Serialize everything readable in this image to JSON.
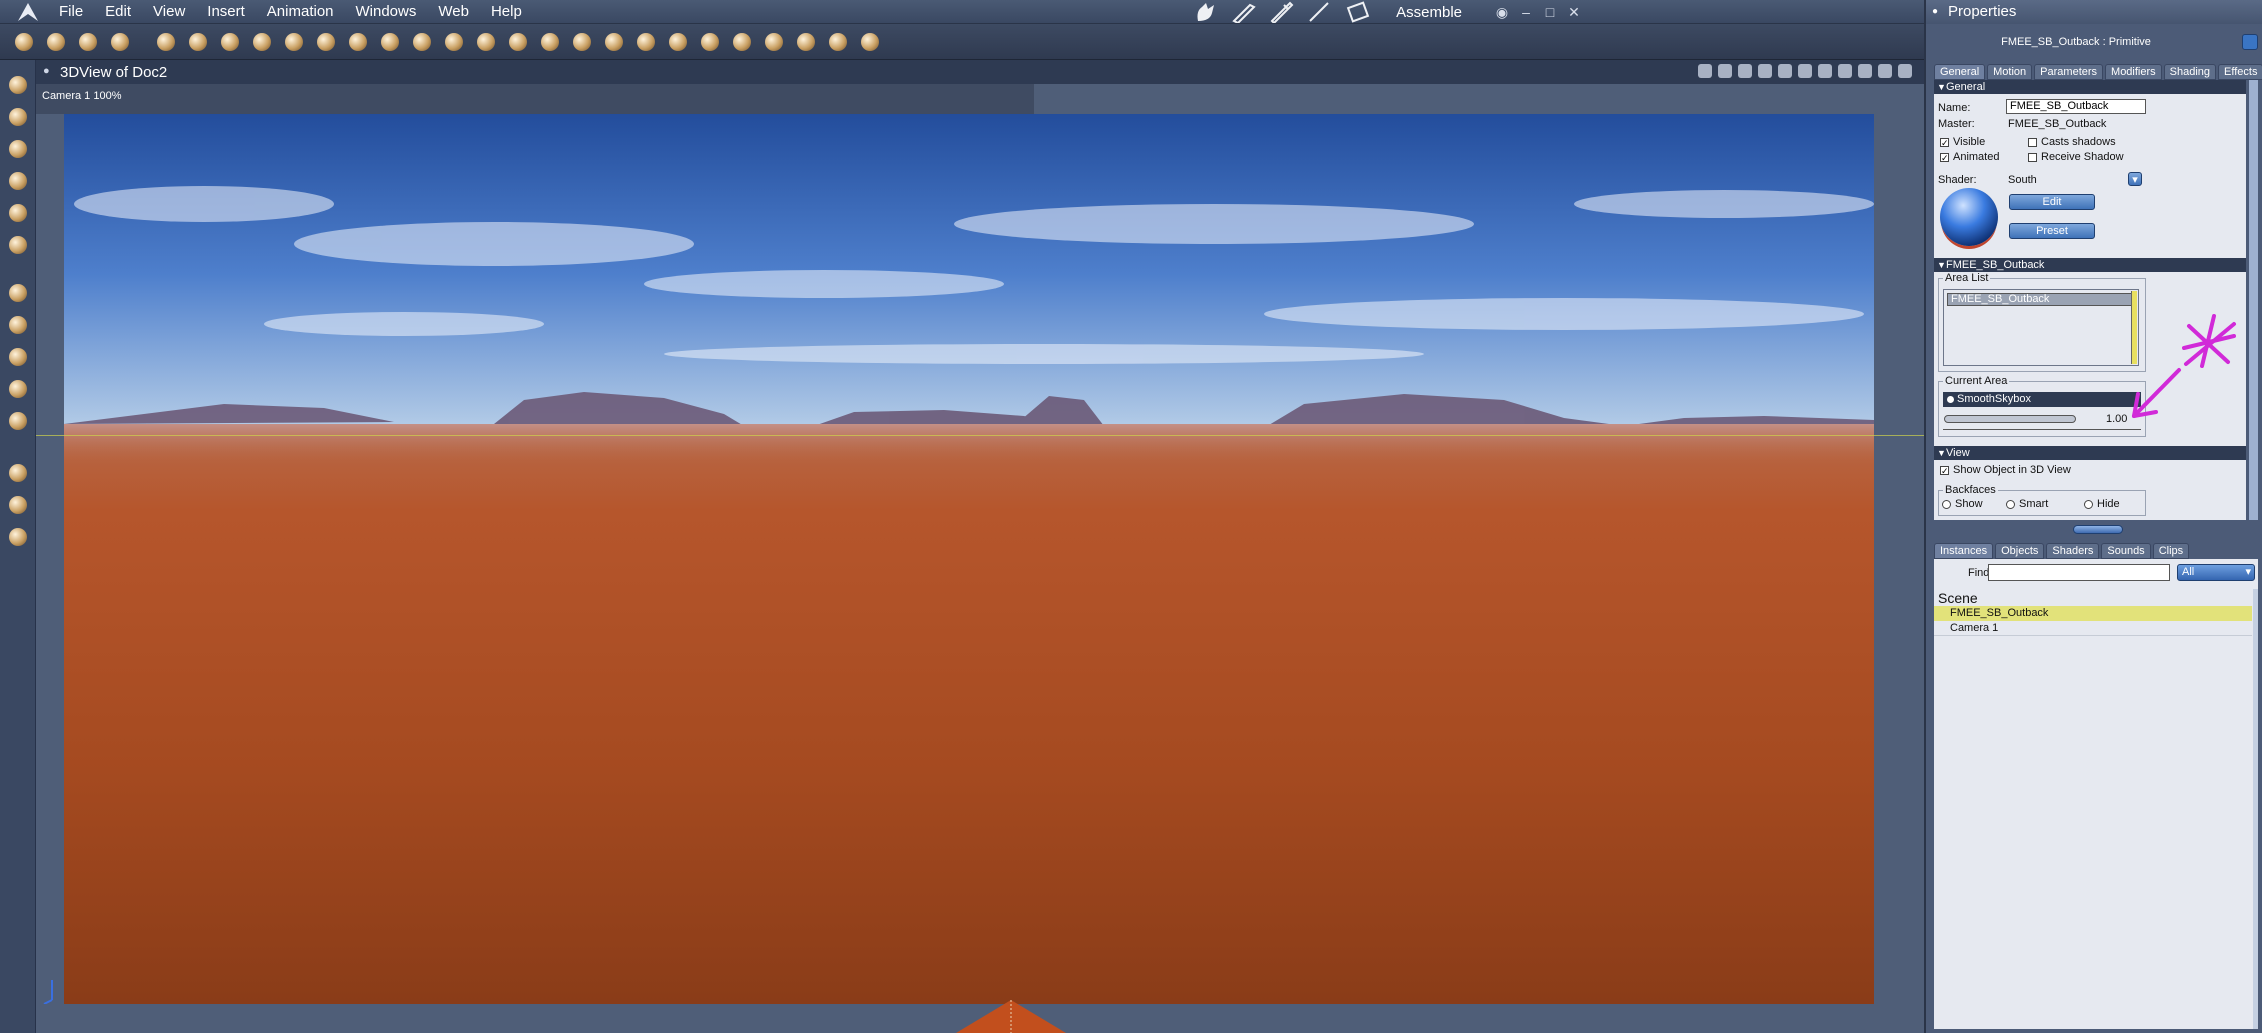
{
  "menubar": {
    "items": [
      "File",
      "Edit",
      "View",
      "Insert",
      "Animation",
      "Windows",
      "Web",
      "Help"
    ],
    "room": "Assemble"
  },
  "viewport": {
    "title": "3DView of Doc2",
    "camera_label": "Camera 1 100%"
  },
  "properties": {
    "title": "Properties",
    "object_title": "FMEE_SB_Outback : Primitive",
    "tabs": [
      "General",
      "Motion",
      "Parameters",
      "Modifiers",
      "Shading",
      "Effects"
    ],
    "general": {
      "section": "General",
      "name_label": "Name:",
      "name_value": "FMEE_SB_Outback",
      "master_label": "Master:",
      "master_value": "FMEE_SB_Outback",
      "visible": "Visible",
      "animated": "Animated",
      "casts_shadows": "Casts shadows",
      "receive_shadow": "Receive Shadow",
      "shader_label": "Shader:",
      "shader_value": "South",
      "edit_button": "Edit",
      "preset_button": "Preset"
    },
    "object_section": {
      "title": "FMEE_SB_Outback",
      "area_list_label": "Area List",
      "area_list_items": [
        "FMEE_SB_Outback"
      ],
      "current_area_label": "Current Area",
      "current_area_value": "SmoothSkybox",
      "slider_value": "1.00"
    },
    "view_section": {
      "title": "View",
      "show_object": "Show Object in 3D View",
      "backfaces_label": "Backfaces",
      "show": "Show",
      "smart": "Smart",
      "hide": "Hide"
    }
  },
  "library": {
    "tabs": [
      "Instances",
      "Objects",
      "Shaders",
      "Sounds",
      "Clips"
    ],
    "find_label": "Find:",
    "filter_value": "All",
    "scene_label": "Scene",
    "rows": [
      "FMEE_SB_Outback",
      "Camera 1"
    ]
  },
  "colors": {
    "annotation": "#d12ad8",
    "selection": "#e2e27a",
    "accent": "#3f72b8"
  }
}
